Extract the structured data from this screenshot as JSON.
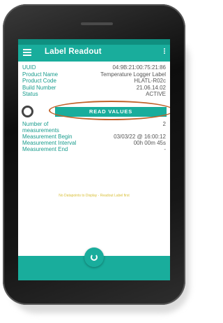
{
  "appbar": {
    "title": "Label Readout"
  },
  "device_info": [
    {
      "label": "UUID",
      "value": "04:9B:21:00:75:21:86"
    },
    {
      "label": "Product Name",
      "value": "Temperature Logger Label"
    },
    {
      "label": "Product Code",
      "value": "HLATL-R02c"
    },
    {
      "label": "Build Number",
      "value": "21.06.14.02"
    },
    {
      "label": "Status",
      "value": "ACTIVE"
    }
  ],
  "read_button": {
    "label": "READ VALUES"
  },
  "measurements": {
    "count_label_line1": "Number of",
    "count_label_line2": "measurements",
    "count_value": "2",
    "begin_label": "Measurement Begin",
    "begin_value": "03/03/22 @ 16:00:12",
    "interval_label": "Measurement Interval",
    "interval_value": "00h 00m 45s",
    "end_label": "Measurement End",
    "end_value": "-"
  },
  "empty_message": "No Datapoints to Display - Readout Label first",
  "icons": {
    "menu": "hamburger-menu-icon",
    "more": "more-vertical-icon",
    "fab": "refresh-icon",
    "toggle": "ring-toggle-icon"
  },
  "colors": {
    "accent": "#19ad9c",
    "status_bar": "#0f8f80",
    "highlight_oval": "#c0622a",
    "empty_text": "#d9c03a"
  }
}
